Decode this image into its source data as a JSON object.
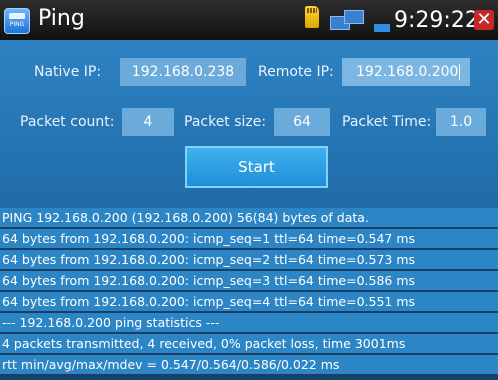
{
  "titlebar": {
    "app_icon_text": "PING",
    "title": "Ping",
    "time": "9:29:22",
    "icons": [
      "sd-card-icon",
      "network-icon",
      "battery-icon",
      "close-icon"
    ]
  },
  "form": {
    "native_ip_label": "Native IP:",
    "native_ip_value": "192.168.0.238",
    "remote_ip_label": "Remote IP:",
    "remote_ip_value": "192.168.0.200",
    "packet_count_label": "Packet count:",
    "packet_count_value": "4",
    "packet_size_label": "Packet size:",
    "packet_size_value": "64",
    "packet_time_label": "Packet Time:",
    "packet_time_value": "1.0",
    "start_label": "Start"
  },
  "output": [
    "PING 192.168.0.200 (192.168.0.200) 56(84) bytes of data.",
    "64 bytes from 192.168.0.200: icmp_seq=1 ttl=64 time=0.547 ms",
    "64 bytes from 192.168.0.200: icmp_seq=2 ttl=64 time=0.573 ms",
    "64 bytes from 192.168.0.200: icmp_seq=3 ttl=64 time=0.586 ms",
    "64 bytes from 192.168.0.200: icmp_seq=4 ttl=64 time=0.551 ms",
    "--- 192.168.0.200 ping statistics ---",
    "4 packets transmitted, 4 received, 0% packet loss, time 3001ms",
    "rtt min/avg/max/mdev = 0.547/0.564/0.586/0.022 ms"
  ],
  "colors": {
    "panel": "#2f83c3",
    "field": "#6aabdc",
    "button": "#3fb1f0",
    "output_row": "#2c86c6",
    "close": "#c62828"
  }
}
